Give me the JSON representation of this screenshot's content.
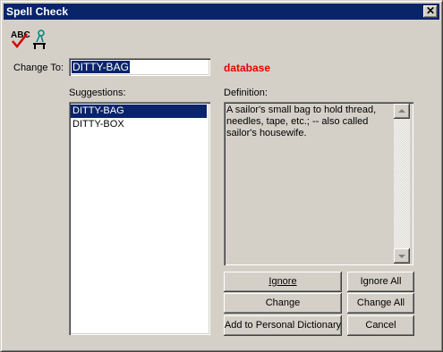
{
  "window": {
    "title": "Spell Check",
    "close_label": "✕"
  },
  "toolbar": {
    "icon": "abc-spellcheck-icon"
  },
  "change_to": {
    "label": "Change To:",
    "value": "DITTY-BAG"
  },
  "misspelled_word": "database",
  "suggestions": {
    "label": "Suggestions:",
    "items": [
      "DITTY-BAG",
      "DITTY-BOX"
    ],
    "selected_index": 0
  },
  "definition": {
    "label": "Definition:",
    "text": "A sailor's small bag to hold thread, needles, tape, etc.; -- also called sailor's housewife."
  },
  "buttons": {
    "ignore": "Ignore",
    "ignore_all": "Ignore All",
    "change": "Change",
    "change_all": "Change All",
    "add_to_dictionary": "Add to Personal Dictionary",
    "cancel": "Cancel"
  },
  "colors": {
    "title_bar": "#0a246a",
    "misspelled_word": "#e60000",
    "face": "#d4d0c8"
  }
}
